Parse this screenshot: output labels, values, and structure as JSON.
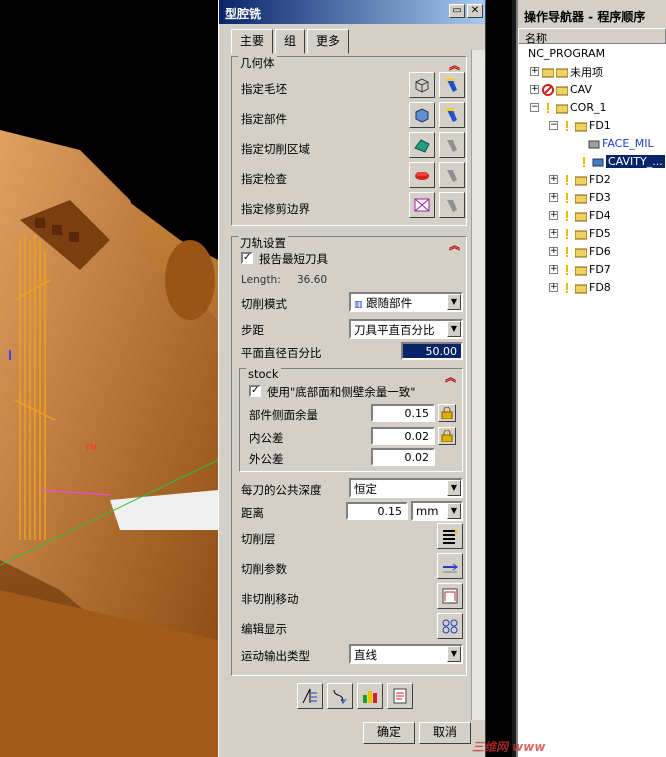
{
  "dialog": {
    "title": "型腔铣",
    "tabs": [
      "主要",
      "组",
      "更多"
    ],
    "geometry": {
      "header": "几何体",
      "rows": [
        "指定毛坯",
        "指定部件",
        "指定切削区域",
        "指定检查",
        "指定修剪边界"
      ]
    },
    "toolpath": {
      "header": "刀轨设置",
      "report_shortest_tool": "报告最短刀具",
      "length_label": "Length:",
      "length_value": "36.60",
      "cut_mode_label": "切削模式",
      "cut_mode_value": "跟随部件",
      "stepover_label": "步距",
      "stepover_value": "刀具平直百分比",
      "flat_pct_label": "平面直径百分比",
      "flat_pct_value": "50.00",
      "stock": {
        "header": "stock",
        "same_floor_wall": "使用\"底部面和侧壁余量一致\"",
        "part_side_label": "部件侧面余量",
        "part_side_value": "0.15",
        "intol_label": "内公差",
        "intol_value": "0.02",
        "outtol_label": "外公差",
        "outtol_value": "0.02"
      },
      "common_depth_label": "每刀的公共深度",
      "common_depth_value": "恒定",
      "distance_label": "距离",
      "distance_value": "0.15",
      "distance_unit": "mm",
      "cut_levels": "切削层",
      "cut_params": "切削参数",
      "non_cut_moves": "非切削移动",
      "edit_display": "编辑显示",
      "motion_output_label": "运动输出类型",
      "motion_output_value": "直线"
    },
    "ok": "确定",
    "cancel": "取消"
  },
  "navigator": {
    "title": "操作导航器 - 程序顺序",
    "column": "名称",
    "items": [
      {
        "label": "NC_PROGRAM"
      },
      {
        "label": "未用项"
      },
      {
        "label": "CAV"
      },
      {
        "label": "COR_1"
      },
      {
        "label": "FD1"
      },
      {
        "label": "FACE_MIL"
      },
      {
        "label": "CAVITY_..."
      },
      {
        "label": "FD2"
      },
      {
        "label": "FD3"
      },
      {
        "label": "FD4"
      },
      {
        "label": "FD5"
      },
      {
        "label": "FD6"
      },
      {
        "label": "FD7"
      },
      {
        "label": "FD8"
      }
    ]
  },
  "watermark": "三维网 www",
  "colors": {
    "title_blue": "#0a246a",
    "select_blue": "#0a246a",
    "model_orange": "#c87a2a"
  }
}
